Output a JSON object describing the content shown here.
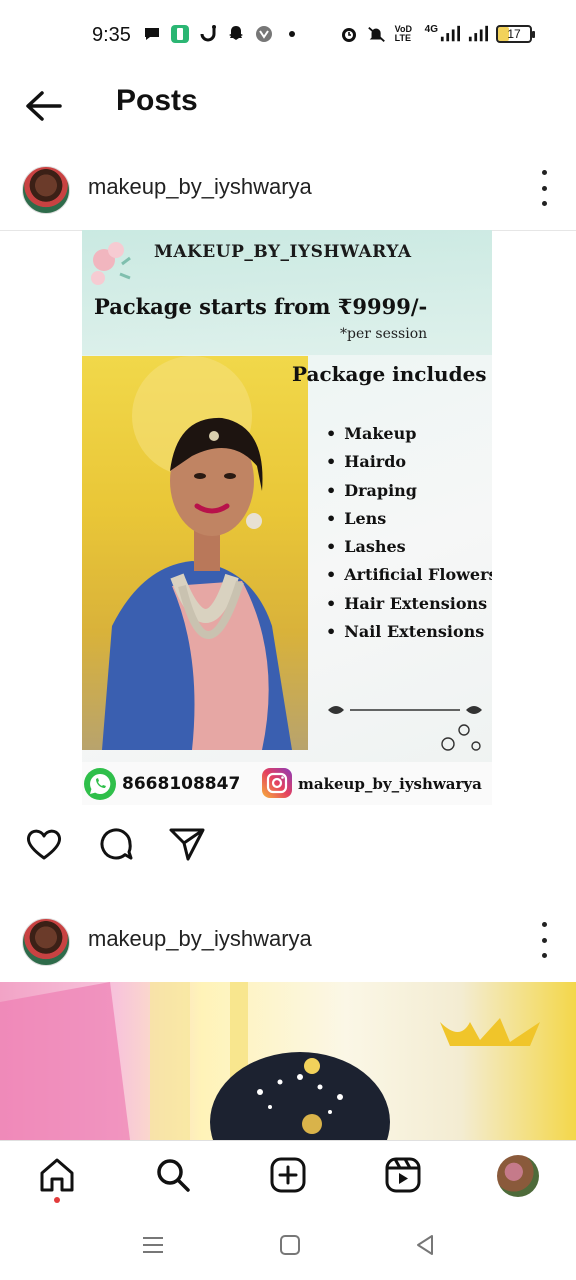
{
  "status_bar": {
    "time": "9:35",
    "battery": "17",
    "left_icons": [
      "message-icon",
      "app-icon",
      "hook-icon",
      "snapchat-icon",
      "vpn-icon",
      "dot"
    ],
    "right_icons": [
      "alarm-icon",
      "mute-icon",
      "volte-icon",
      "signal-icon",
      "signal-icon-2",
      "battery-icon"
    ],
    "network_label": "VoD LTE",
    "net_type": "4G"
  },
  "app_bar": {
    "title": "Posts"
  },
  "posts": [
    {
      "username": "makeup_by_iyshwarya",
      "image": {
        "brand": "MAKEUP_BY_IYSHWARYA",
        "package_line": "Package starts from  ₹9999/-",
        "per_session": "*per session",
        "includes_title": "Package includes",
        "includes": [
          "Makeup",
          "Hairdo",
          "Draping",
          "Lens",
          "Lashes",
          "Artificial Flowers",
          "Hair Extensions",
          "Nail Extensions"
        ],
        "phone": "8668108847",
        "handle": "makeup_by_iyshwarya"
      }
    },
    {
      "username": "makeup_by_iyshwarya"
    }
  ],
  "bottom_nav": [
    "home-icon",
    "search-icon",
    "create-icon",
    "reels-icon",
    "profile-avatar"
  ],
  "colors": {
    "accent_dot": "#e23b3b",
    "whatsapp": "#2fbf4a"
  }
}
